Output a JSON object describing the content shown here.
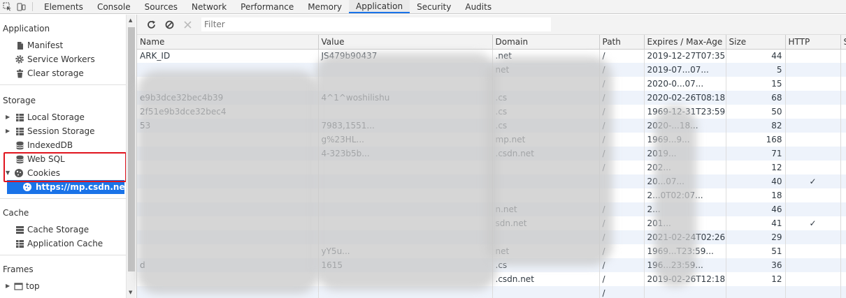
{
  "topbar": {
    "tabs": [
      "Elements",
      "Console",
      "Sources",
      "Network",
      "Performance",
      "Memory",
      "Application",
      "Security",
      "Audits"
    ],
    "active_tab": "Application"
  },
  "sidebar": {
    "application": {
      "title": "Application",
      "items": [
        "Manifest",
        "Service Workers",
        "Clear storage"
      ]
    },
    "storage": {
      "title": "Storage",
      "items": [
        "Local Storage",
        "Session Storage",
        "IndexedDB",
        "Web SQL",
        "Cookies"
      ],
      "cookie_origin": "https://mp.csdn.net"
    },
    "cache": {
      "title": "Cache",
      "items": [
        "Cache Storage",
        "Application Cache"
      ]
    },
    "frames": {
      "title": "Frames",
      "items": [
        "top"
      ]
    }
  },
  "toolbar": {
    "filter_placeholder": "Filter"
  },
  "table": {
    "columns": [
      "Name",
      "Value",
      "Domain",
      "Path",
      "Expires / Max-Age",
      "Size",
      "HTTP",
      "Se"
    ],
    "rows": [
      {
        "name": "ARK_ID",
        "value": "JS479b90437",
        "domain": ".net",
        "path": "/",
        "expires": "2019-12-27T07:35...",
        "size": "44",
        "http": ""
      },
      {
        "name": "",
        "value": "",
        "domain": "net",
        "path": "/",
        "expires": "2019-07...07...",
        "size": "5",
        "http": ""
      },
      {
        "name": "",
        "value": "",
        "domain": "",
        "path": "/",
        "expires": "2020-0...07...",
        "size": "15",
        "http": ""
      },
      {
        "name": "e9b3dce32bec4b39",
        "value": "4^1^woshilishu",
        "domain": ".cs",
        "path": "/",
        "expires": "2020-02-26T08:18...",
        "size": "68",
        "http": ""
      },
      {
        "name": "2f51e9b3dce32bec4",
        "value": "",
        "domain": ".cs",
        "path": "/",
        "expires": "1969-12-31T23:59...",
        "size": "50",
        "http": ""
      },
      {
        "name": "53",
        "value": "7983,1551...",
        "domain": ".cs",
        "path": "/",
        "expires": "2020-...18...",
        "size": "82",
        "http": ""
      },
      {
        "name": "",
        "value": "g%23HL...",
        "domain": "mp.net",
        "path": "/",
        "expires": "1969...9...",
        "size": "168",
        "http": ""
      },
      {
        "name": "",
        "value": "4-323b5b...",
        "domain": ".csdn.net",
        "path": "/",
        "expires": "2019...",
        "size": "71",
        "http": ""
      },
      {
        "name": "",
        "value": "",
        "domain": "",
        "path": "/",
        "expires": "202...",
        "size": "12",
        "http": ""
      },
      {
        "name": "",
        "value": "",
        "domain": "",
        "path": "",
        "expires": "20...07...",
        "size": "40",
        "http": "✓"
      },
      {
        "name": "",
        "value": "",
        "domain": "",
        "path": "",
        "expires": "2...0T02:07...",
        "size": "18",
        "http": ""
      },
      {
        "name": "",
        "value": "",
        "domain": "n.net",
        "path": "/",
        "expires": "2...",
        "size": "46",
        "http": ""
      },
      {
        "name": "",
        "value": "",
        "domain": "sdn.net",
        "path": "/",
        "expires": "201...",
        "size": "41",
        "http": "✓"
      },
      {
        "name": "",
        "value": "",
        "domain": "",
        "path": "/",
        "expires": "2021-02-24T02:26...",
        "size": "29",
        "http": ""
      },
      {
        "name": "",
        "value": "yY5u...",
        "domain": "net",
        "path": "/",
        "expires": "1969...T23:59...",
        "size": "51",
        "http": ""
      },
      {
        "name": "d",
        "value": "1615",
        "domain": ".cs",
        "path": "/",
        "expires": "196...23:59...",
        "size": "36",
        "http": ""
      },
      {
        "name": "",
        "value": "",
        "domain": ".csdn.net",
        "path": "/",
        "expires": "2019-02-26T12:18...",
        "size": "12",
        "http": ""
      },
      {
        "name": "",
        "value": "",
        "domain": "",
        "path": "/",
        "expires": "",
        "size": "",
        "http": ""
      }
    ]
  }
}
